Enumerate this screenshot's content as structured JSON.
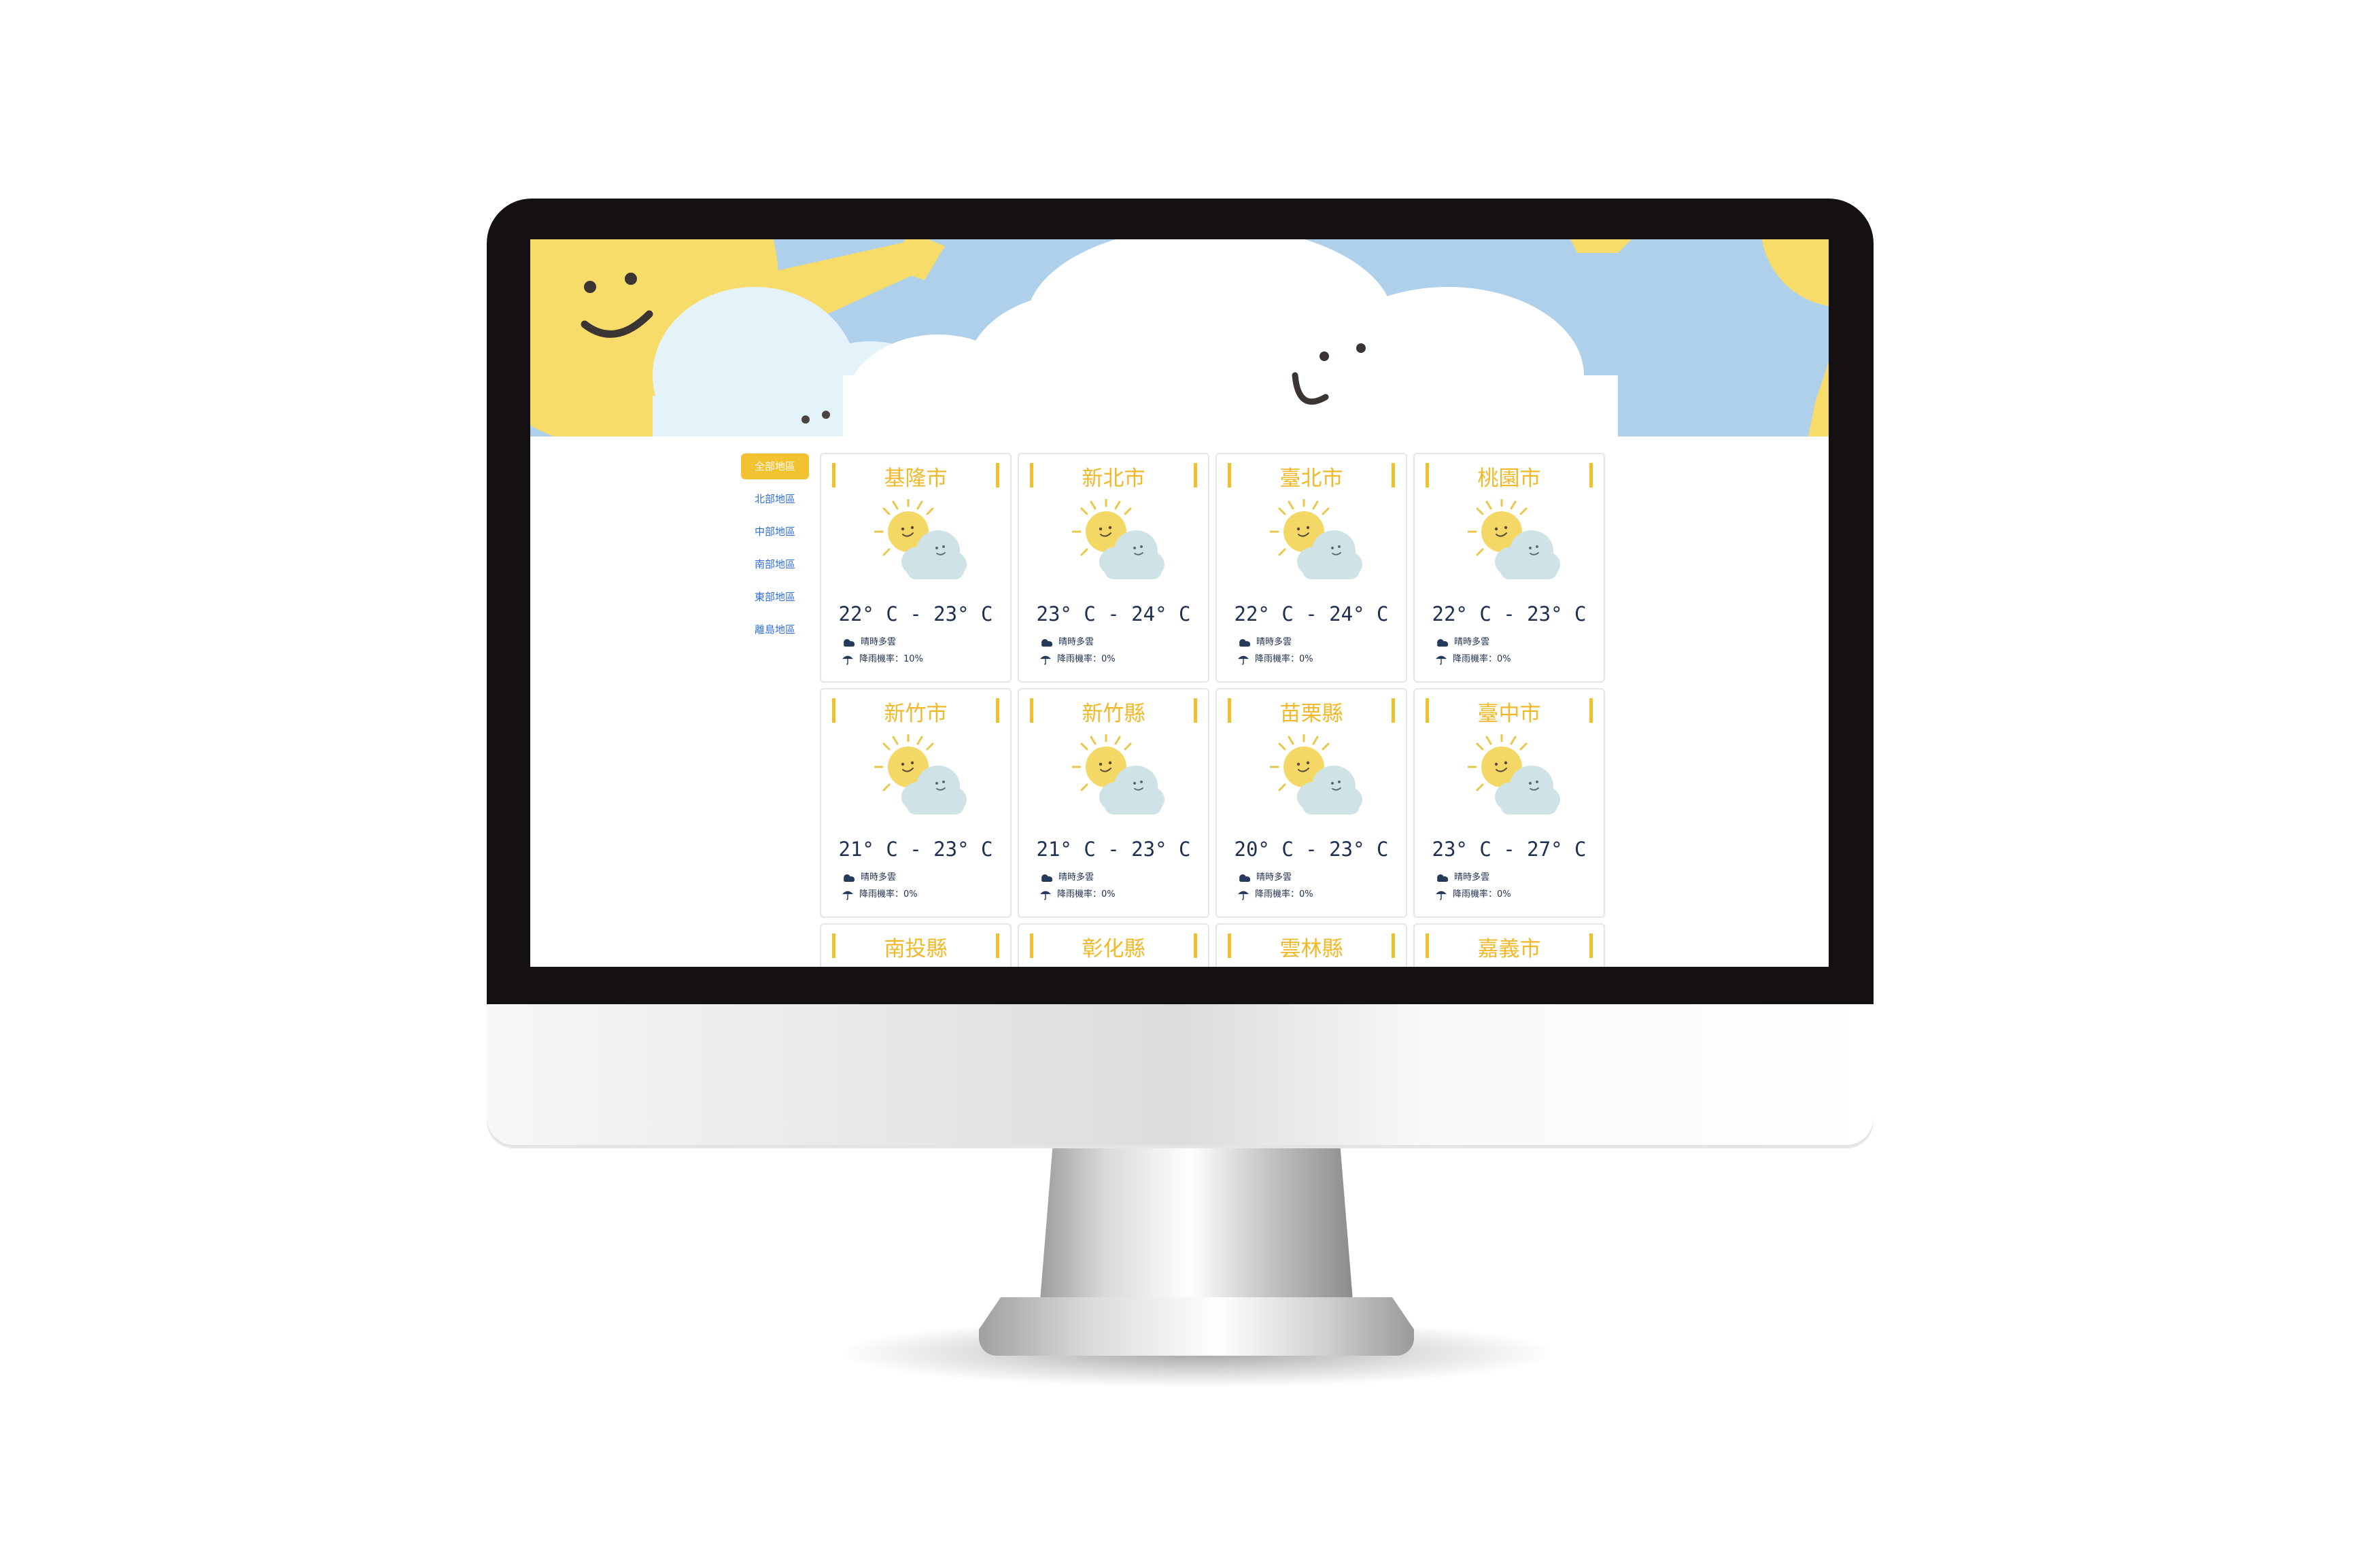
{
  "colors": {
    "sky": "#aed0ea",
    "sun": "#f7dc69",
    "accent": "#f2c230",
    "cloud_light": "#e4f2fa",
    "text_dark": "#1f2f4f",
    "link_blue": "#2f6fd6"
  },
  "sidebar": {
    "items": [
      {
        "label": "全部地區",
        "active": true
      },
      {
        "label": "北部地區",
        "active": false
      },
      {
        "label": "中部地區",
        "active": false
      },
      {
        "label": "南部地區",
        "active": false
      },
      {
        "label": "東部地區",
        "active": false
      },
      {
        "label": "離島地區",
        "active": false
      }
    ]
  },
  "cards": [
    {
      "city": "基隆市",
      "temp": "22° C - 23° C",
      "weather": "晴時多雲",
      "rain": "降雨機率：10%"
    },
    {
      "city": "新北市",
      "temp": "23° C - 24° C",
      "weather": "晴時多雲",
      "rain": "降雨機率：0%"
    },
    {
      "city": "臺北市",
      "temp": "22° C - 24° C",
      "weather": "晴時多雲",
      "rain": "降雨機率：0%"
    },
    {
      "city": "桃園市",
      "temp": "22° C - 23° C",
      "weather": "晴時多雲",
      "rain": "降雨機率：0%"
    },
    {
      "city": "新竹市",
      "temp": "21° C - 23° C",
      "weather": "晴時多雲",
      "rain": "降雨機率：0%"
    },
    {
      "city": "新竹縣",
      "temp": "21° C - 23° C",
      "weather": "晴時多雲",
      "rain": "降雨機率：0%"
    },
    {
      "city": "苗栗縣",
      "temp": "20° C - 23° C",
      "weather": "晴時多雲",
      "rain": "降雨機率：0%"
    },
    {
      "city": "臺中市",
      "temp": "23° C - 27° C",
      "weather": "晴時多雲",
      "rain": "降雨機率：0%"
    },
    {
      "city": "南投縣"
    },
    {
      "city": "彰化縣"
    },
    {
      "city": "雲林縣"
    },
    {
      "city": "嘉義市"
    }
  ]
}
